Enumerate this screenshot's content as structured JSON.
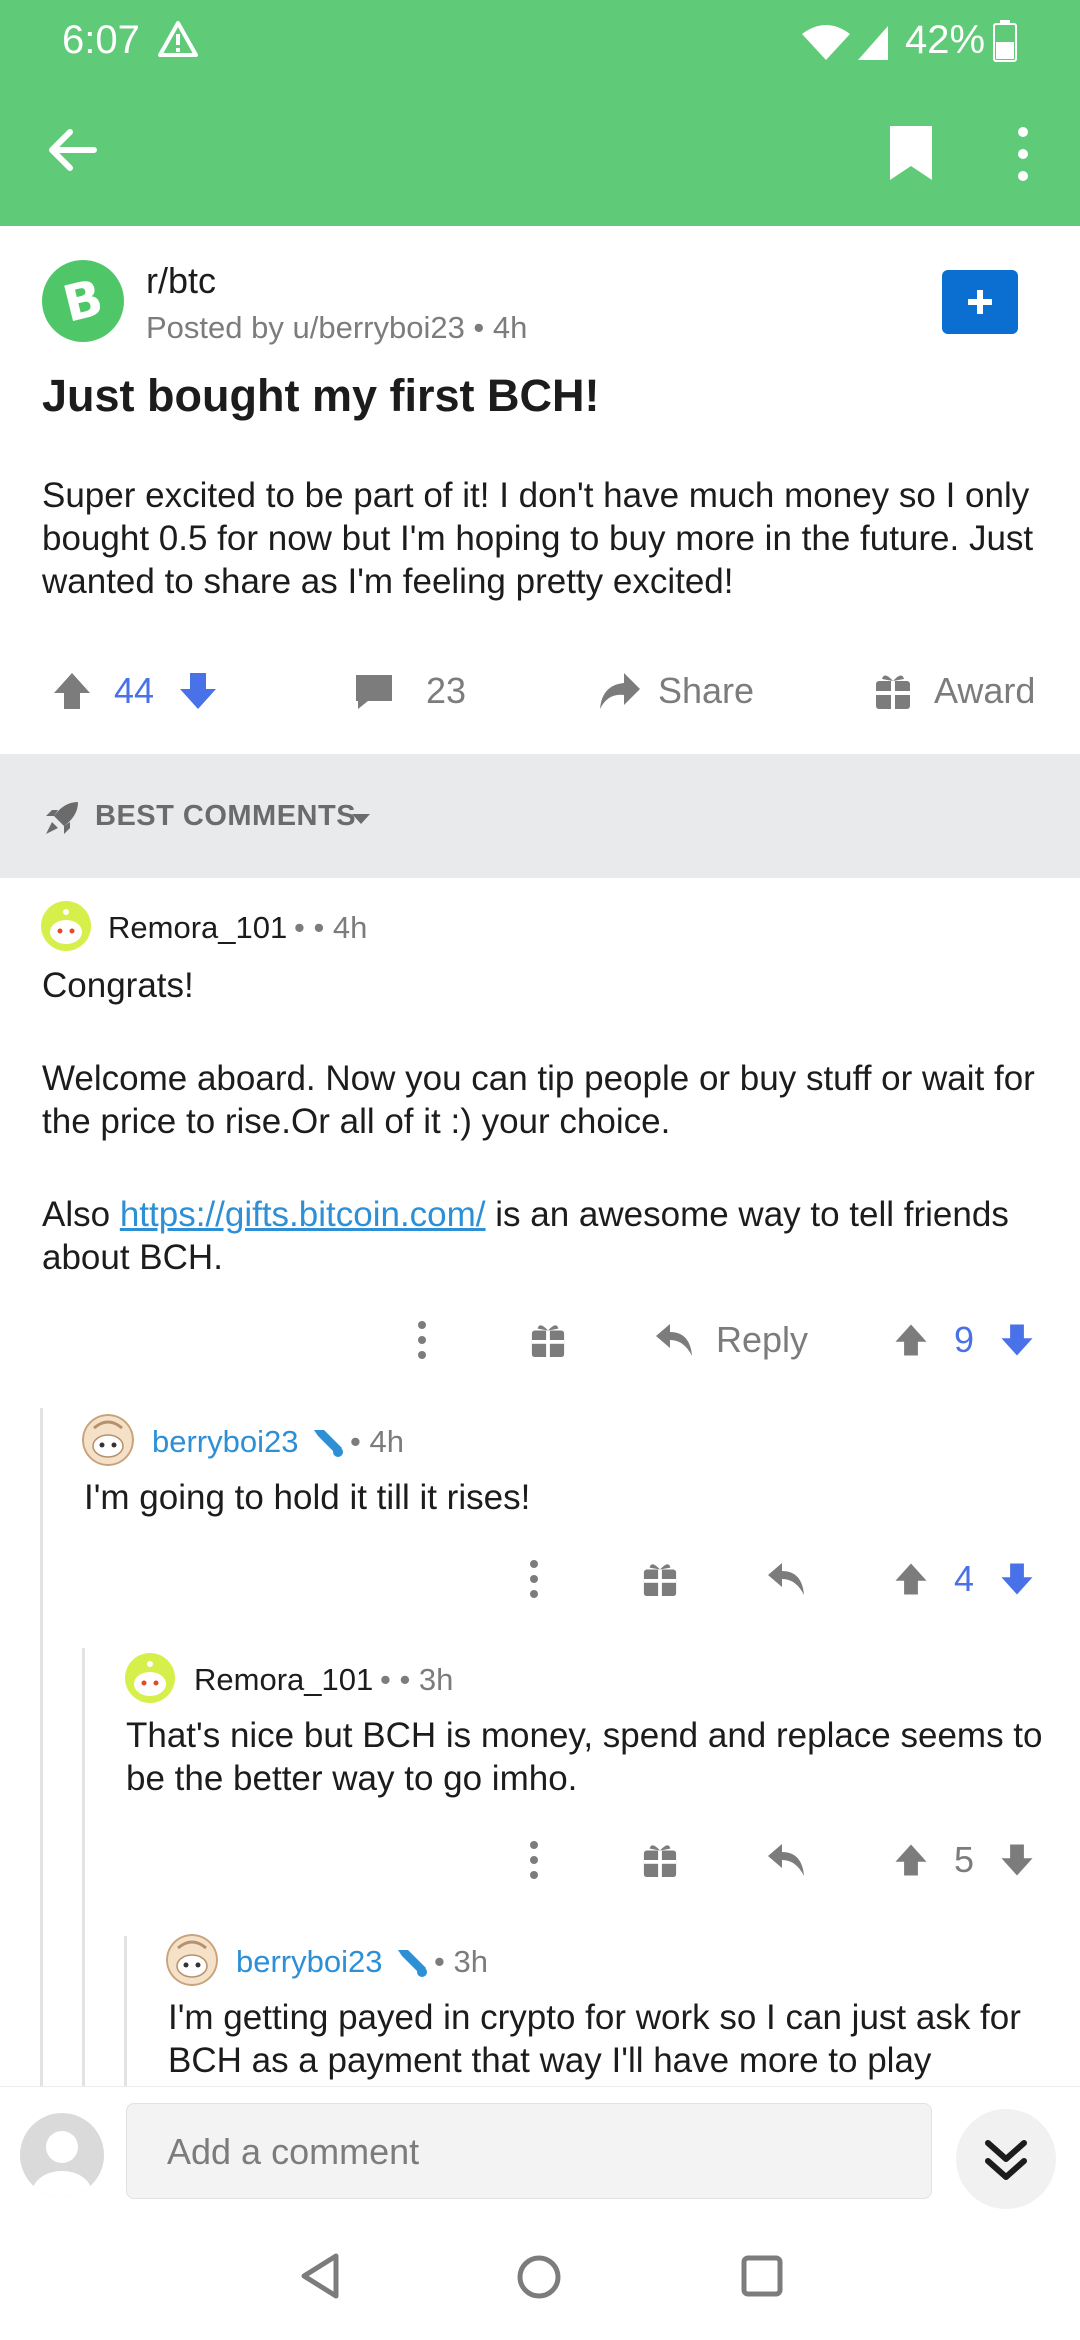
{
  "status": {
    "time": "6:07",
    "battery": "42%"
  },
  "post": {
    "subreddit": "r/btc",
    "meta": "Posted by u/berryboi23 • 4h",
    "title": "Just bought my first BCH!",
    "body": "Super excited to be part of it! I don't have much money so I only bought 0.5 for now but I'm hoping to buy more in the future. Just wanted to share as I'm feeling pretty excited!",
    "score": "44",
    "comments": "23",
    "share_label": "Share",
    "award_label": "Award"
  },
  "sort": {
    "label": "BEST COMMENTS"
  },
  "comments": [
    {
      "author": "Remora_101",
      "meta": "• • 4h",
      "text_1": "Congrats!",
      "text_2": "Welcome aboard. Now you can tip people or buy stuff or wait for the price to rise.Or all of it :) your choice.",
      "text_3_link": "https://gifts.bitcoin.com/",
      "text_3_rest": " is an awesome way to tell friends about BCH.",
      "text_3_prefix": "Also ",
      "reply_label": "Reply",
      "score": "9"
    },
    {
      "author": "berryboi23",
      "meta": "• 4h",
      "text": "I'm going to hold it till it rises!",
      "score": "4"
    },
    {
      "author": "Remora_101",
      "meta": "• • 3h",
      "text": "That's nice but BCH is money, spend and replace seems to be the better way to go imho.",
      "score": "5"
    },
    {
      "author": "berryboi23",
      "meta": "• 3h",
      "text": "I'm getting payed in crypto for work so I can just ask for BCH as a payment that way I'll have more to play"
    }
  ],
  "compose": {
    "placeholder": "Add a comment"
  },
  "colors": {
    "header": "#5fca77",
    "accent_blue": "#4a72e8",
    "link": "#2d8fd6",
    "join": "#0a6fd0"
  }
}
